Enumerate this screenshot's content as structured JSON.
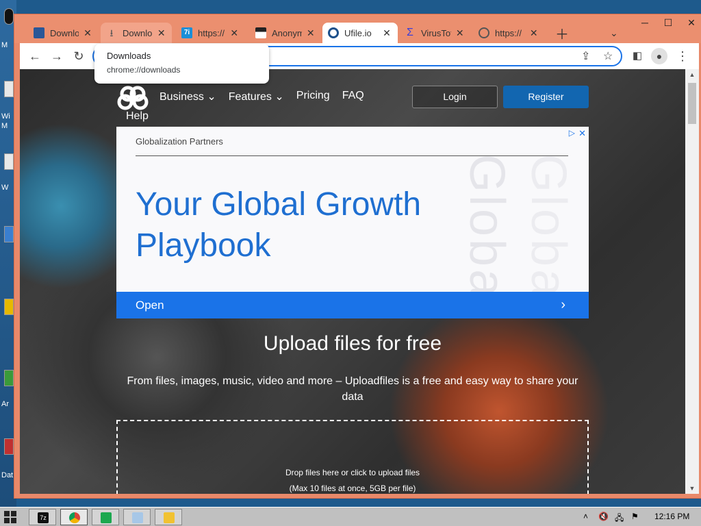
{
  "desktop": {
    "labels": [
      "M",
      "Wi",
      "M",
      "W",
      "Ar",
      "Dat"
    ]
  },
  "tabs": [
    {
      "title": "Downlo",
      "icon": "document-icon",
      "state": "normal"
    },
    {
      "title": "Downlo",
      "icon": "download-icon",
      "state": "hover"
    },
    {
      "title": "https://",
      "icon": "7i-icon",
      "state": "normal"
    },
    {
      "title": "Anonym",
      "icon": "anonymous-icon",
      "state": "normal"
    },
    {
      "title": "Ufile.io",
      "icon": "ufile-icon",
      "state": "active"
    },
    {
      "title": "VirusTot",
      "icon": "virustotal-icon",
      "state": "normal"
    },
    {
      "title": "https://",
      "icon": "globe-icon",
      "state": "normal"
    }
  ],
  "tooltip": {
    "title": "Downloads",
    "url": "chrome://downloads"
  },
  "site": {
    "nav": [
      "Business ⌄",
      "Features ⌄",
      "Pricing",
      "FAQ"
    ],
    "help": "Help",
    "login": "Login",
    "register": "Register"
  },
  "ad": {
    "brand": "Globalization Partners",
    "headline": "Your Global Growth Playbook",
    "watermark": "Globaliz",
    "open": "Open"
  },
  "hero": {
    "title": "Upload files for free",
    "subtitle": "From files, images, music, video and more – Uploadfiles is a free and easy way to share your data"
  },
  "dropzone": {
    "line1": "Drop files here or click to upload files",
    "line2": "(Max 10 files at once, 5GB per file)"
  },
  "taskbar": {
    "clock": "12:16 PM"
  },
  "colors": {
    "accent": "#1a73e8",
    "register": "#1266b0",
    "titlebar": "#eb8f6f"
  }
}
